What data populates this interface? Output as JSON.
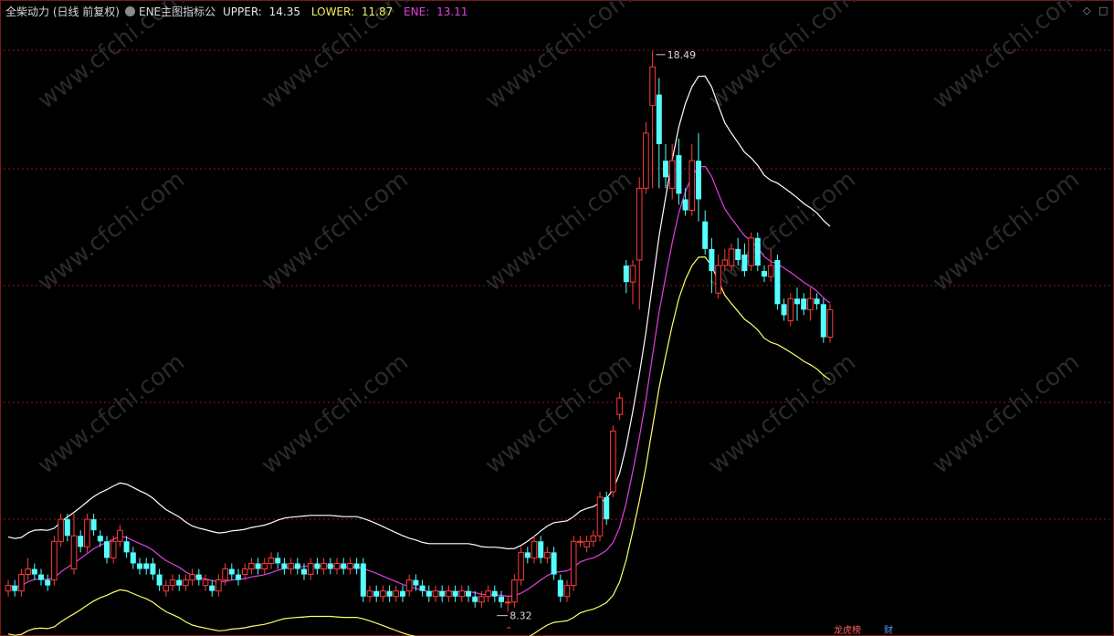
{
  "header": {
    "name_label": "全柴动力 (日线 前复权)",
    "indicator_label": "ENE主图指标公",
    "upper_label": "UPPER:",
    "upper_value": "14.35",
    "lower_label": "LOWER:",
    "lower_value": "11.87",
    "ene_label": "ENE:",
    "ene_value": "13.11"
  },
  "controls": {
    "diamond": "◇",
    "square": "□"
  },
  "watermark": "www.cfchi.com",
  "colors": {
    "up": "#ff3b3b",
    "down": "#54ffff",
    "upper": "#ffffff",
    "lower": "#ffff66",
    "ene": "#e040e0",
    "grid": "#8c1a1a"
  },
  "chart_data": {
    "type": "candlestick",
    "ylim": [
      8.0,
      19.0
    ],
    "annotations": {
      "high": "18.49",
      "low": "8.32"
    },
    "bottom_markers": [
      {
        "text": "⌃",
        "color": "#ff4040"
      },
      {
        "text": "龙虎榜",
        "color": "#ff6060"
      },
      {
        "text": "财",
        "color": "#5599ff"
      }
    ],
    "candles": [
      [
        8.7,
        8.8,
        8.6,
        8.9
      ],
      [
        8.8,
        8.7,
        8.6,
        8.9
      ],
      [
        8.7,
        9.0,
        8.6,
        9.1
      ],
      [
        9.0,
        9.1,
        8.9,
        9.3
      ],
      [
        9.1,
        9.0,
        8.9,
        9.2
      ],
      [
        9.0,
        8.9,
        8.8,
        9.1
      ],
      [
        8.9,
        8.8,
        8.7,
        9.0
      ],
      [
        8.9,
        9.6,
        8.8,
        9.7
      ],
      [
        9.6,
        10.0,
        9.5,
        10.1
      ],
      [
        10.0,
        9.7,
        9.6,
        10.1
      ],
      [
        9.1,
        9.7,
        9.0,
        10.1
      ],
      [
        9.7,
        9.5,
        9.4,
        9.8
      ],
      [
        9.5,
        10.0,
        9.4,
        10.1
      ],
      [
        10.0,
        9.8,
        9.7,
        10.1
      ],
      [
        9.7,
        9.6,
        9.5,
        9.8
      ],
      [
        9.6,
        9.3,
        9.2,
        9.7
      ],
      [
        9.3,
        9.6,
        9.2,
        9.7
      ],
      [
        9.6,
        9.8,
        9.5,
        9.9
      ],
      [
        9.6,
        9.4,
        9.3,
        9.7
      ],
      [
        9.4,
        9.2,
        9.1,
        9.5
      ],
      [
        9.2,
        9.1,
        9.0,
        9.3
      ],
      [
        9.2,
        9.1,
        9.0,
        9.3
      ],
      [
        9.2,
        9.0,
        8.9,
        9.3
      ],
      [
        9.0,
        8.8,
        8.7,
        9.1
      ],
      [
        8.7,
        8.8,
        8.6,
        8.9
      ],
      [
        8.8,
        8.9,
        8.7,
        9.0
      ],
      [
        8.9,
        8.8,
        8.7,
        9.0
      ],
      [
        8.8,
        8.9,
        8.7,
        9.0
      ],
      [
        8.9,
        9.0,
        8.8,
        9.1
      ],
      [
        9.0,
        8.9,
        8.8,
        9.1
      ],
      [
        8.8,
        8.9,
        8.7,
        9.0
      ],
      [
        8.8,
        8.7,
        8.6,
        8.9
      ],
      [
        8.7,
        8.9,
        8.6,
        9.0
      ],
      [
        8.9,
        9.1,
        8.8,
        9.2
      ],
      [
        9.1,
        9.0,
        8.9,
        9.2
      ],
      [
        9.0,
        8.9,
        8.8,
        9.1
      ],
      [
        9.0,
        9.1,
        8.9,
        9.2
      ],
      [
        9.1,
        9.2,
        9.0,
        9.3
      ],
      [
        9.2,
        9.1,
        9.0,
        9.3
      ],
      [
        9.1,
        9.2,
        9.0,
        9.3
      ],
      [
        9.2,
        9.3,
        9.1,
        9.4
      ],
      [
        9.3,
        9.2,
        9.1,
        9.4
      ],
      [
        9.2,
        9.1,
        9.0,
        9.3
      ],
      [
        9.1,
        9.2,
        9.0,
        9.3
      ],
      [
        9.2,
        9.1,
        9.0,
        9.3
      ],
      [
        9.1,
        9.0,
        8.9,
        9.2
      ],
      [
        9.0,
        9.2,
        8.9,
        9.3
      ],
      [
        9.2,
        9.1,
        9.0,
        9.3
      ],
      [
        9.1,
        9.2,
        9.0,
        9.3
      ],
      [
        9.2,
        9.1,
        9.0,
        9.3
      ],
      [
        9.1,
        9.2,
        9.0,
        9.3
      ],
      [
        9.2,
        9.1,
        9.0,
        9.3
      ],
      [
        9.1,
        9.2,
        9.0,
        9.3
      ],
      [
        9.2,
        9.1,
        9.0,
        9.3
      ],
      [
        9.2,
        8.6,
        8.5,
        9.3
      ],
      [
        8.6,
        8.7,
        8.5,
        8.8
      ],
      [
        8.7,
        8.6,
        8.5,
        8.8
      ],
      [
        8.6,
        8.7,
        8.5,
        8.8
      ],
      [
        8.7,
        8.6,
        8.5,
        8.8
      ],
      [
        8.6,
        8.7,
        8.5,
        8.8
      ],
      [
        8.7,
        8.6,
        8.5,
        8.8
      ],
      [
        8.7,
        8.9,
        8.6,
        9.0
      ],
      [
        8.9,
        8.8,
        8.7,
        9.0
      ],
      [
        8.8,
        8.7,
        8.6,
        8.9
      ],
      [
        8.7,
        8.6,
        8.5,
        8.8
      ],
      [
        8.6,
        8.7,
        8.5,
        8.8
      ],
      [
        8.7,
        8.6,
        8.5,
        8.8
      ],
      [
        8.6,
        8.7,
        8.5,
        8.8
      ],
      [
        8.7,
        8.6,
        8.5,
        8.8
      ],
      [
        8.6,
        8.7,
        8.5,
        8.8
      ],
      [
        8.7,
        8.6,
        8.5,
        8.8
      ],
      [
        8.6,
        8.5,
        8.4,
        8.7
      ],
      [
        8.5,
        8.6,
        8.4,
        8.7
      ],
      [
        8.6,
        8.7,
        8.5,
        8.8
      ],
      [
        8.7,
        8.6,
        8.5,
        8.8
      ],
      [
        8.6,
        8.5,
        8.4,
        8.7
      ],
      [
        8.5,
        8.5,
        8.32,
        8.6
      ],
      [
        8.5,
        8.9,
        8.4,
        9.0
      ],
      [
        8.9,
        9.4,
        8.8,
        9.5
      ],
      [
        9.4,
        9.3,
        9.2,
        9.5
      ],
      [
        9.3,
        9.6,
        9.2,
        9.7
      ],
      [
        9.6,
        9.3,
        9.2,
        9.7
      ],
      [
        9.3,
        9.4,
        9.2,
        9.5
      ],
      [
        9.4,
        9.0,
        8.9,
        9.5
      ],
      [
        8.9,
        8.6,
        8.5,
        9.0
      ],
      [
        8.6,
        8.8,
        8.5,
        8.9
      ],
      [
        8.8,
        9.6,
        8.7,
        9.7
      ],
      [
        9.6,
        9.6,
        9.5,
        9.7
      ],
      [
        9.5,
        9.6,
        9.4,
        9.7
      ],
      [
        9.6,
        9.7,
        9.5,
        9.8
      ],
      [
        9.7,
        10.4,
        9.6,
        10.5
      ],
      [
        10.4,
        10.0,
        9.9,
        10.5
      ],
      [
        10.5,
        11.6,
        10.4,
        11.7
      ],
      [
        11.9,
        12.2,
        11.8,
        12.3
      ],
      [
        14.6,
        14.3,
        14.1,
        14.7
      ],
      [
        14.3,
        14.6,
        13.9,
        14.7
      ],
      [
        14.7,
        16.0,
        13.8,
        16.2
      ],
      [
        16.0,
        17.0,
        15.9,
        17.2
      ],
      [
        17.5,
        18.2,
        16.0,
        18.49
      ],
      [
        17.7,
        16.8,
        16.0,
        18.0
      ],
      [
        16.5,
        16.2,
        16.0,
        16.8
      ],
      [
        16.0,
        16.5,
        15.8,
        16.8
      ],
      [
        16.6,
        15.9,
        15.7,
        16.9
      ],
      [
        15.8,
        15.6,
        15.5,
        16.0
      ],
      [
        15.6,
        16.5,
        15.5,
        16.8
      ],
      [
        16.5,
        15.8,
        15.4,
        17.0
      ],
      [
        15.4,
        14.9,
        14.8,
        15.6
      ],
      [
        14.9,
        14.5,
        14.1,
        15.1
      ],
      [
        14.1,
        14.6,
        14.0,
        14.8
      ],
      [
        14.6,
        14.7,
        14.5,
        14.9
      ],
      [
        14.6,
        14.9,
        14.5,
        15.0
      ],
      [
        14.9,
        14.7,
        14.6,
        15.1
      ],
      [
        14.8,
        14.5,
        14.4,
        15.0
      ],
      [
        14.6,
        15.1,
        14.5,
        15.2
      ],
      [
        15.1,
        14.6,
        14.5,
        15.2
      ],
      [
        14.5,
        14.4,
        14.3,
        14.6
      ],
      [
        14.4,
        14.6,
        14.3,
        14.9
      ],
      [
        14.7,
        13.9,
        13.8,
        14.8
      ],
      [
        13.9,
        13.7,
        13.6,
        14.0
      ],
      [
        13.6,
        14.0,
        13.5,
        14.1
      ],
      [
        14.0,
        13.9,
        13.6,
        14.2
      ],
      [
        14.0,
        13.8,
        13.7,
        14.1
      ],
      [
        13.8,
        14.0,
        13.6,
        14.2
      ],
      [
        14.0,
        13.9,
        13.8,
        14.1
      ],
      [
        13.9,
        13.3,
        13.2,
        14.0
      ],
      [
        13.3,
        13.8,
        13.2,
        13.9
      ]
    ]
  }
}
